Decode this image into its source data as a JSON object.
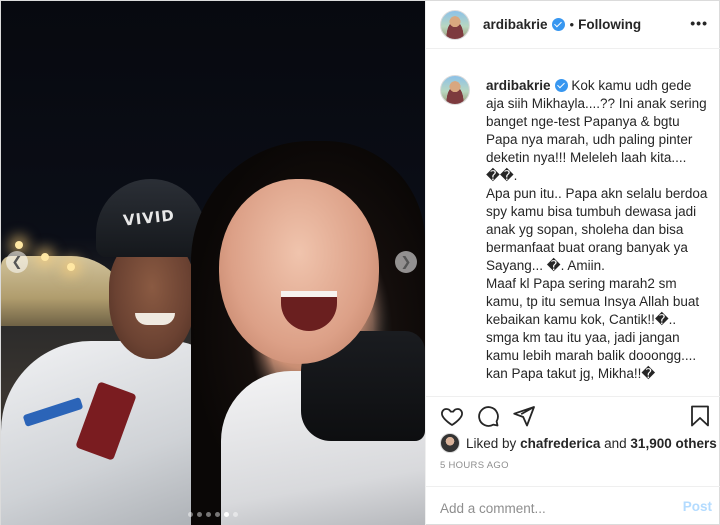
{
  "post": {
    "photo_alt": "",
    "carousel": {
      "total": 6,
      "active_index": 4
    },
    "colors": {
      "accent": "#3897f0",
      "post_disabled": "#b3dbff",
      "muted": "#8e8e8e",
      "border": "#dbdbdb"
    }
  },
  "header": {
    "username": "ardibakrie",
    "separator": "•",
    "follow_status": "Following",
    "more_icon": "more-horizontal-icon"
  },
  "caption": {
    "username": "ardibakrie",
    "text": "Kok kamu udh gede aja siih Mikhayla....?? Ini anak sering banget nge-test Papanya & bgtu Papa nya marah, udh paling pinter deketin nya!!! Meleleh laah kita.... ��.\nApa pun itu.. Papa akn selalu berdoa spy kamu bisa tumbuh dewasa jadi anak yg sopan, sholeha dan bisa bermanfaat buat orang banyak ya Sayang... �. Amiin.\nMaaf kl Papa sering marah2 sm kamu, tp itu semua Insya Allah buat kebaikan kamu kok, Cantik!!�.. smga km tau itu yaa, jadi jangan kamu lebih marah balik dooongg.... kan Papa takut jg, Mikha!!�\n.\nLOVE YOU SO VERY MUCH, MIKHA!!! ���.. semoga at least Papa jadi first love nya kamu yaaaa... �"
  },
  "actions": {
    "like_icon": "heart-icon",
    "comment_icon": "comment-icon",
    "share_icon": "share-icon",
    "save_icon": "bookmark-icon"
  },
  "likes": {
    "prefix": "Liked by ",
    "user": "chafrederica",
    "joiner": " and ",
    "count": "31,900 others"
  },
  "timestamp": "5 HOURS AGO",
  "comment": {
    "placeholder": "Add a comment...",
    "post_label": "Post"
  }
}
